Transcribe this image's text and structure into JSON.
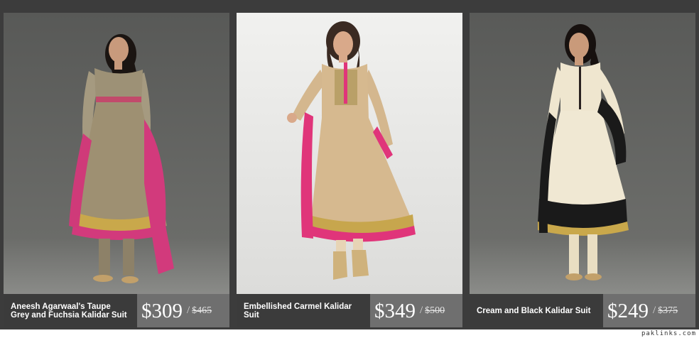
{
  "products": [
    {
      "title": "Aneesh Agarwaal's Taupe Grey and Fuchsia Kalidar Suit",
      "price": "$309",
      "separator": "/",
      "original_price": "$465",
      "image": "model-taupe-grey-fuchsia-kalidar-suit",
      "colors": {
        "background": "#5b5c5a",
        "dress": "#a19478",
        "accent": "#d23a7c"
      }
    },
    {
      "title": "Embellished Carmel Kalidar Suit",
      "price": "$349",
      "separator": "/",
      "original_price": "$500",
      "image": "model-carmel-kalidar-suit",
      "colors": {
        "background": "#e7e7e5",
        "dress": "#d6b98f",
        "accent": "#e0357a"
      }
    },
    {
      "title": "Cream and Black Kalidar Suit",
      "price": "$249",
      "separator": "/",
      "original_price": "$375",
      "image": "model-cream-black-kalidar-suit",
      "colors": {
        "background": "#5e5f5d",
        "dress": "#efe6cf",
        "accent": "#1a1a1a"
      }
    }
  ],
  "watermark": "paklinks.com"
}
